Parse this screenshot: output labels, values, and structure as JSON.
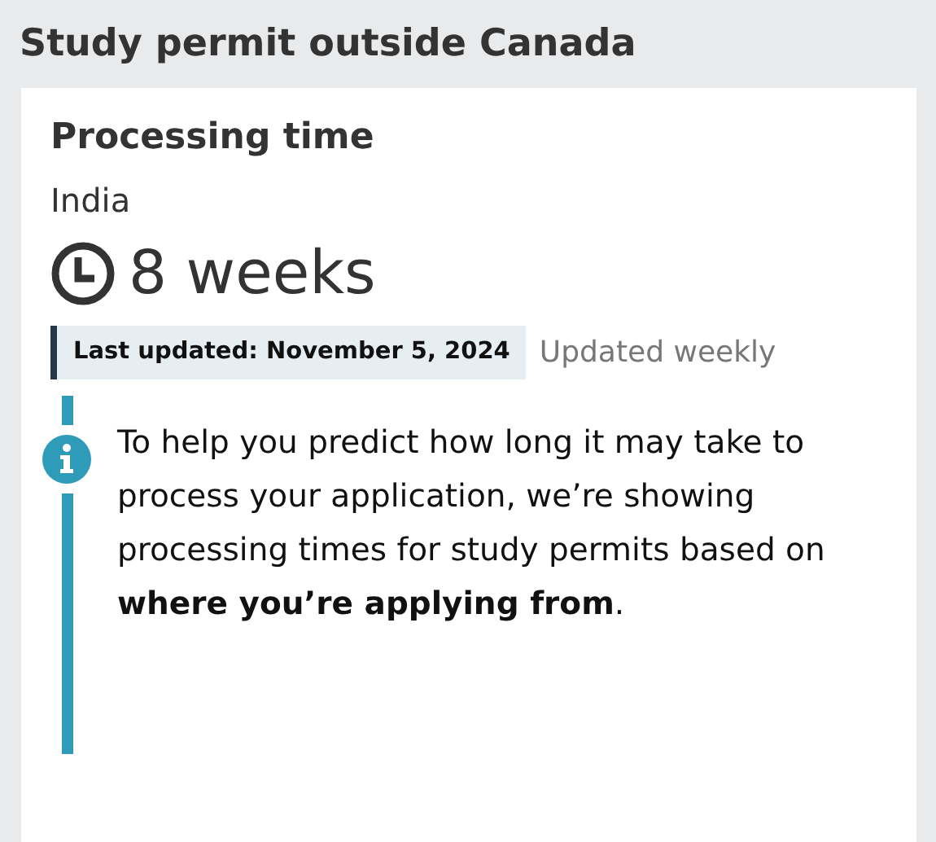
{
  "page_title": "Study permit outside Canada",
  "card": {
    "heading": "Processing time",
    "country": "India",
    "duration": "8 weeks",
    "last_updated": "Last updated: November 5, 2024",
    "update_frequency": "Updated weekly",
    "notice": {
      "kind": "info",
      "text": "To help you predict how long it may take to process your application, we’re showing processing times for study permits based on **where you’re applying from**."
    }
  }
}
